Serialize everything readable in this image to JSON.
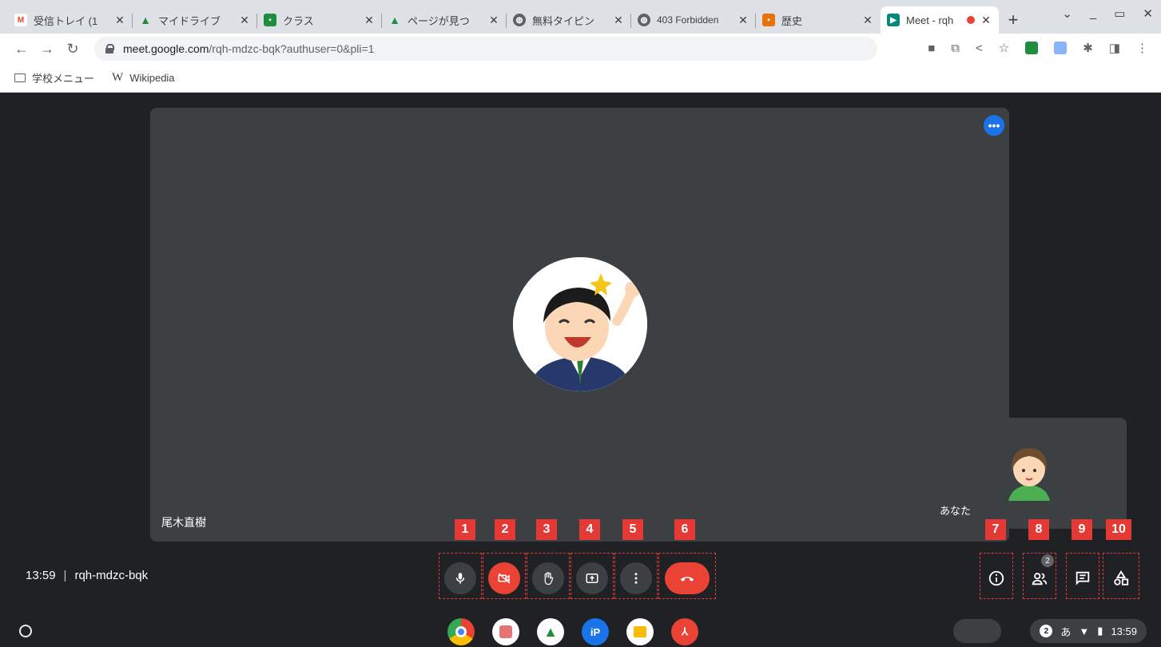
{
  "browser": {
    "tabs": [
      {
        "title": "受信トレイ (1",
        "favicon": "gmail-icon",
        "color": "#ea4335",
        "glyph": "M"
      },
      {
        "title": "マイドライブ",
        "favicon": "drive-icon",
        "color": "#fbbc04",
        "glyph": "▲"
      },
      {
        "title": "クラス",
        "favicon": "classroom-icon",
        "color": "#1e8e3e",
        "glyph": "■"
      },
      {
        "title": "ページが見つ",
        "favicon": "drive-icon",
        "color": "#fbbc04",
        "glyph": "▲"
      },
      {
        "title": "無料タイピン",
        "favicon": "globe-icon",
        "color": "#5f6368",
        "glyph": "◍"
      },
      {
        "title": "403 Forbidden",
        "favicon": "globe-icon",
        "color": "#5f6368",
        "glyph": "◍"
      },
      {
        "title": "歴史",
        "favicon": "slides-icon",
        "color": "#e8710a",
        "glyph": "■"
      }
    ],
    "active_tab": {
      "title": "Meet - rqh",
      "favicon": "meet-icon"
    },
    "url_host": "meet.google.com",
    "url_path": "/rqh-mdzc-bqk?authuser=0&pli=1",
    "bookmarks": [
      {
        "label": "学校メニュー",
        "icon": "folder-icon"
      },
      {
        "label": "Wikipedia",
        "icon": "wikipedia-icon",
        "glyph": "W"
      }
    ]
  },
  "meet": {
    "main_participant_name": "尾木直樹",
    "self_name": "あなた",
    "time": "13:59",
    "separator": "|",
    "meeting_code": "rqh-mdzc-bqk",
    "participant_count": "2",
    "badges": [
      "1",
      "2",
      "3",
      "4",
      "5",
      "6",
      "7",
      "8",
      "9",
      "10"
    ],
    "accent_red": "#ea4335",
    "tile_bg": "#3c4043"
  },
  "shelf": {
    "notification_count": "2",
    "ime": "あ",
    "clock": "13:59"
  }
}
